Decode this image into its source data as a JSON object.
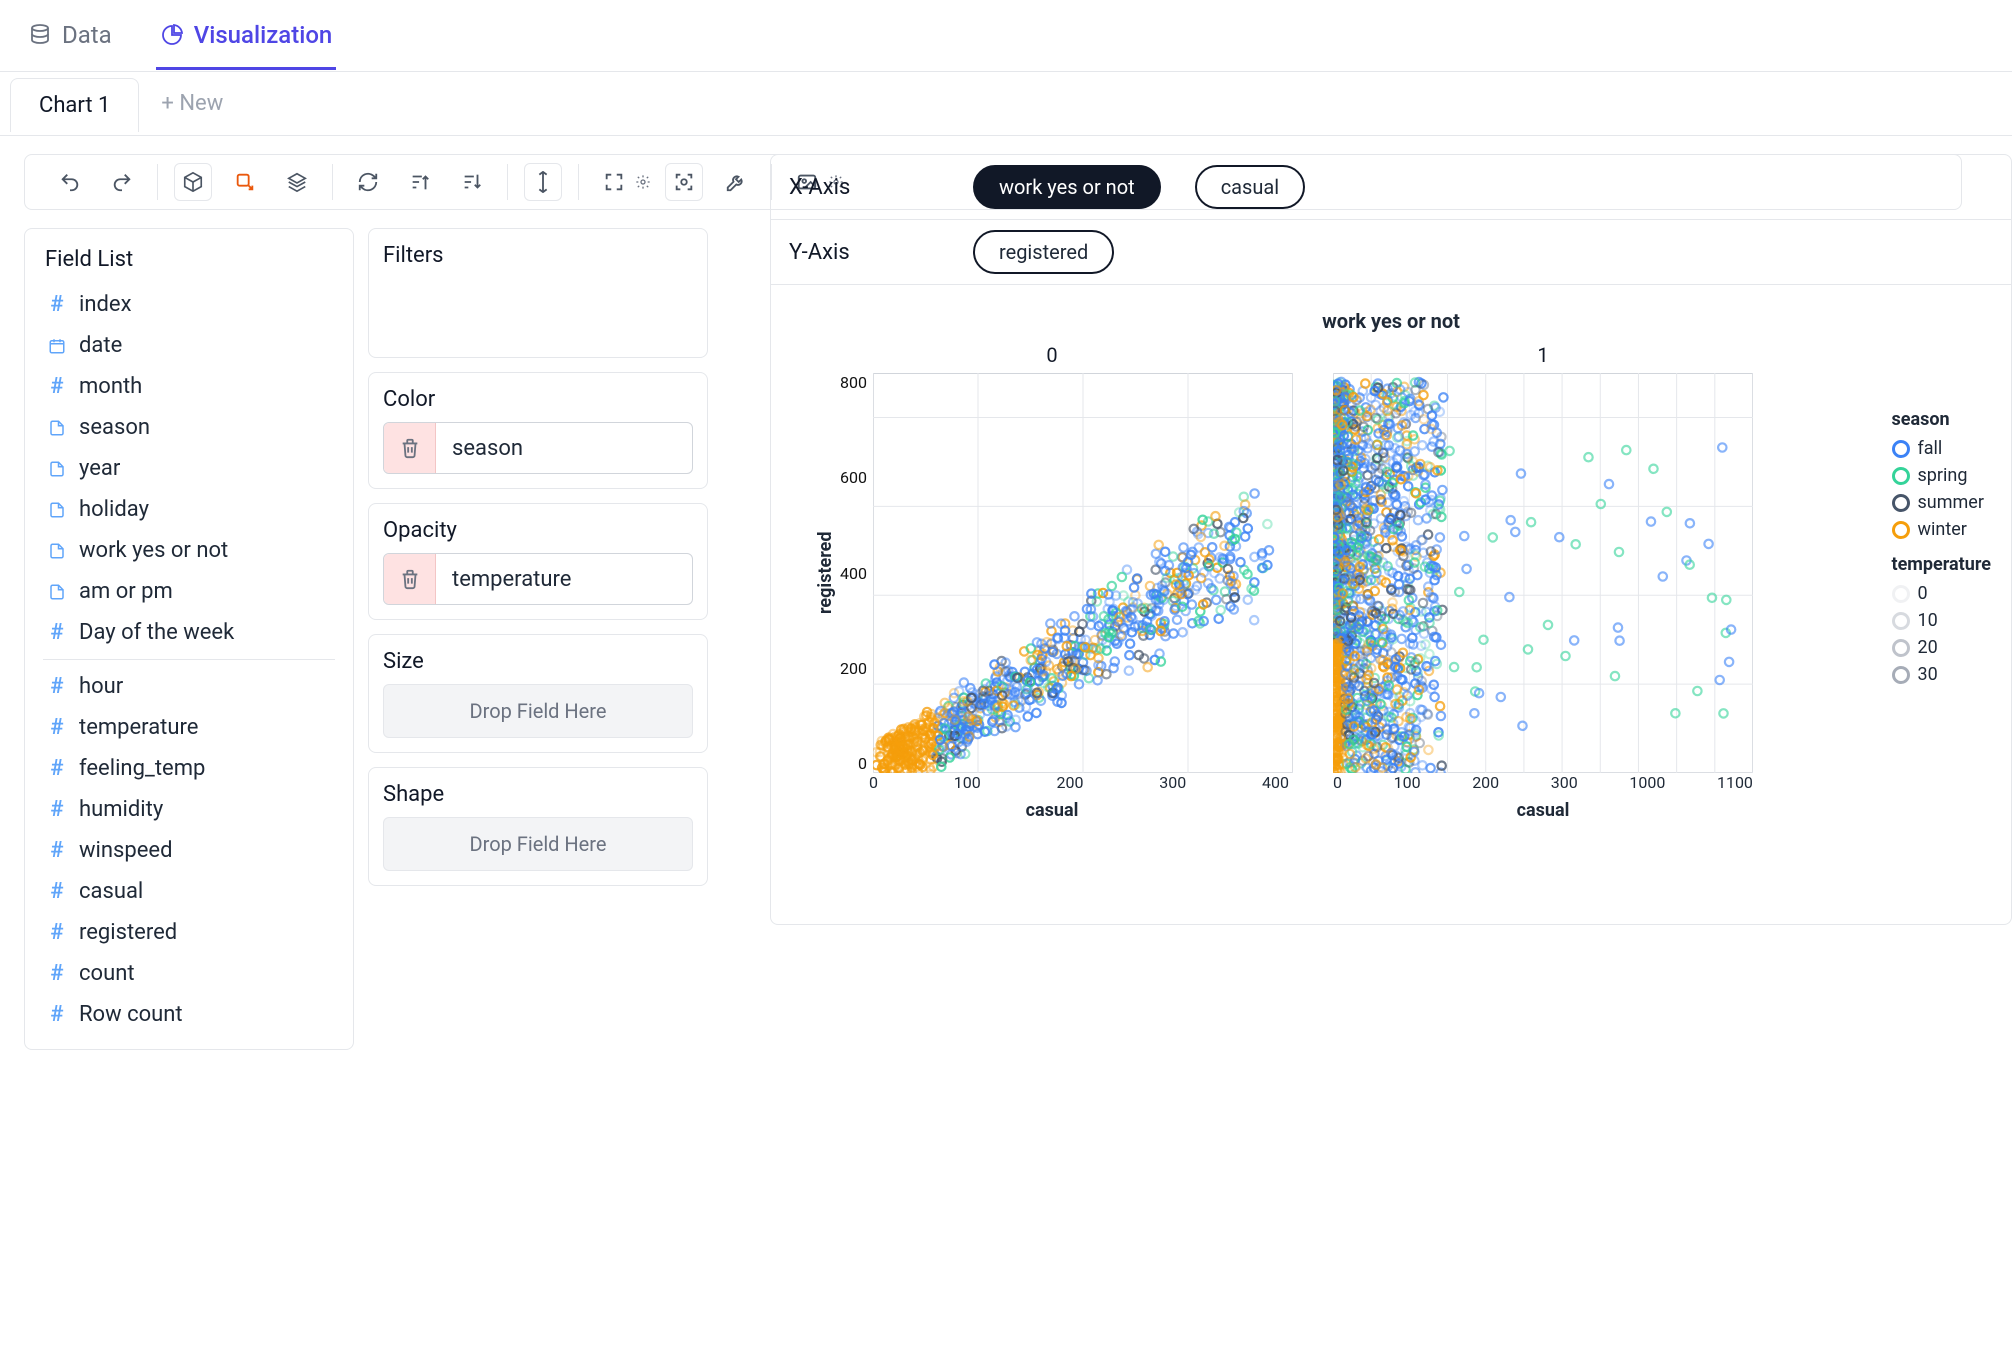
{
  "topnav": {
    "data": "Data",
    "visualization": "Visualization"
  },
  "tabs": {
    "chart1": "Chart 1",
    "new": "+ New"
  },
  "toolbar": {
    "undo": "undo",
    "redo": "redo"
  },
  "fieldlist": {
    "title": "Field List",
    "items_top": [
      {
        "name": "index",
        "type": "number"
      },
      {
        "name": "date",
        "type": "date"
      },
      {
        "name": "month",
        "type": "number"
      },
      {
        "name": "season",
        "type": "text"
      },
      {
        "name": "year",
        "type": "text"
      },
      {
        "name": "holiday",
        "type": "text"
      },
      {
        "name": "work yes or not",
        "type": "text"
      },
      {
        "name": "am or pm",
        "type": "text"
      },
      {
        "name": "Day of the week",
        "type": "number"
      }
    ],
    "items_bottom": [
      {
        "name": "hour",
        "type": "number"
      },
      {
        "name": "temperature",
        "type": "number"
      },
      {
        "name": "feeling_temp",
        "type": "number"
      },
      {
        "name": "humidity",
        "type": "number"
      },
      {
        "name": "winspeed",
        "type": "number"
      },
      {
        "name": "casual",
        "type": "number"
      },
      {
        "name": "registered",
        "type": "number"
      },
      {
        "name": "count",
        "type": "number"
      },
      {
        "name": "Row count",
        "type": "number"
      }
    ]
  },
  "encodings": {
    "filters_title": "Filters",
    "color_title": "Color",
    "color_field": "season",
    "opacity_title": "Opacity",
    "opacity_field": "temperature",
    "size_title": "Size",
    "shape_title": "Shape",
    "drop_placeholder": "Drop Field Here"
  },
  "axis": {
    "x_label": "X-Axis",
    "x_fields": [
      "work yes or not",
      "casual"
    ],
    "y_label": "Y-Axis",
    "y_fields": [
      "registered"
    ]
  },
  "chart_data": {
    "type": "scatter",
    "facet_field": "work yes or not",
    "facet_title": "work yes or not",
    "facets": [
      "0",
      "1"
    ],
    "xlabel": "casual",
    "ylabel": "registered",
    "xlim_0": [
      0,
      400
    ],
    "xlim_1": [
      0,
      1100
    ],
    "ylim": [
      0,
      900
    ],
    "x_ticks_0": [
      0,
      100,
      200,
      300,
      400
    ],
    "x_ticks_1": [
      0,
      100,
      200,
      300,
      1000,
      1100
    ],
    "y_ticks": [
      0,
      200,
      400,
      600,
      800
    ],
    "color_field": "season",
    "color_legend": [
      {
        "name": "fall",
        "color": "#3b82f6"
      },
      {
        "name": "spring",
        "color": "#34d399"
      },
      {
        "name": "summer",
        "color": "#475569"
      },
      {
        "name": "winter",
        "color": "#f59e0b"
      }
    ],
    "opacity_field": "temperature",
    "opacity_legend": [
      {
        "name": "0"
      },
      {
        "name": "10"
      },
      {
        "name": "20"
      },
      {
        "name": "30"
      }
    ],
    "note": "Scatter points are dense; individual point values not readable from image. Facet 0 shows a thick positively-correlated cloud from (~0,0) to (~350,500) dominated by winter (amber) and fall (blue). Facet 1 shows a very dense vertical cluster near x≈10–120 spanning y≈0–900 with outliers up to x≈1050, colored by all four seasons."
  }
}
